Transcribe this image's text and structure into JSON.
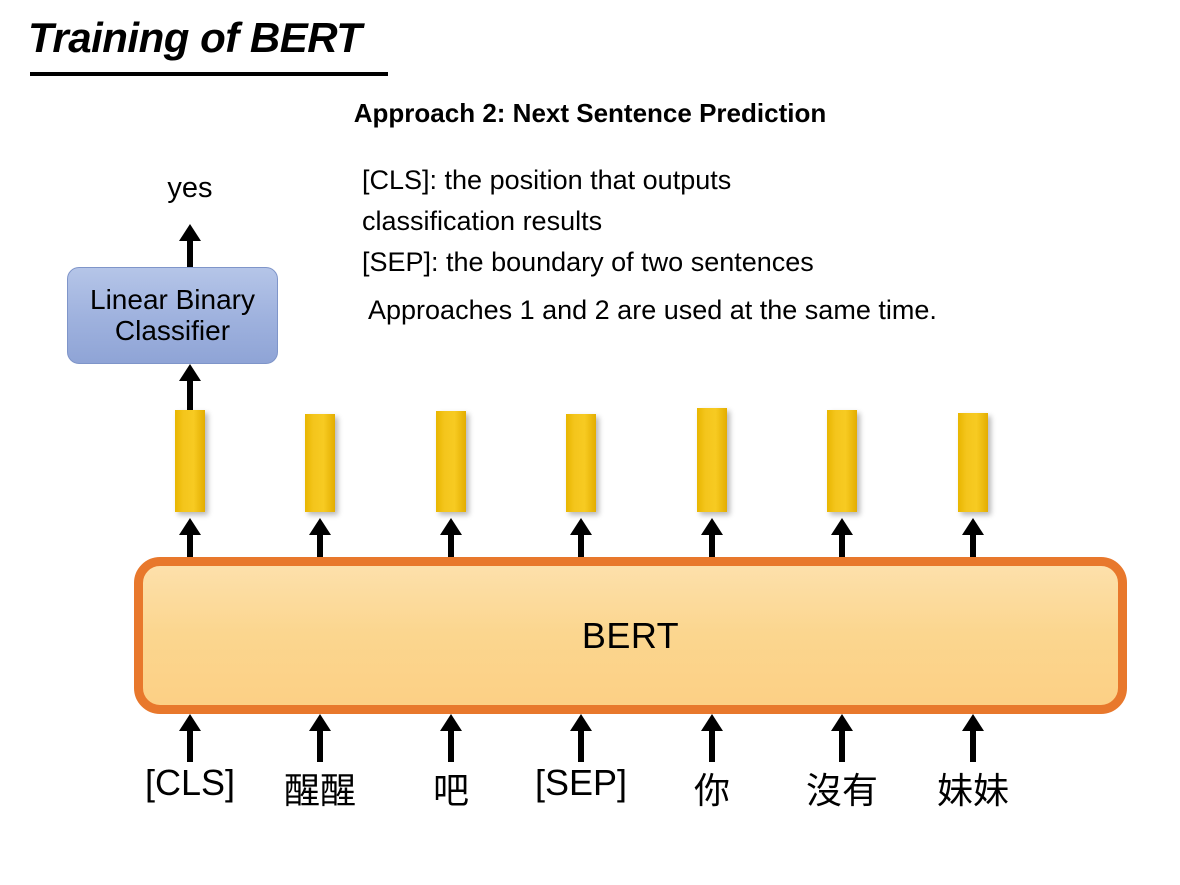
{
  "slide": {
    "title": "Training of BERT",
    "subtitle": "Approach 2: Next Sentence Prediction"
  },
  "notes": {
    "lines": [
      "[CLS]: the position that outputs",
      "classification results",
      "[SEP]: the boundary of two sentences"
    ],
    "footer": "Approaches 1 and 2 are used at the same time."
  },
  "diagram": {
    "output_label": "yes",
    "classifier": {
      "line1": "Linear Binary",
      "line2": "Classifier"
    },
    "encoder_label": "BERT",
    "tokens": [
      {
        "text": "[CLS]",
        "cjk": false
      },
      {
        "text": "醒醒",
        "cjk": true
      },
      {
        "text": "吧",
        "cjk": true
      },
      {
        "text": "[SEP]",
        "cjk": false
      },
      {
        "text": "你",
        "cjk": true
      },
      {
        "text": "沒有",
        "cjk": true
      },
      {
        "text": "妹妹",
        "cjk": true
      }
    ],
    "embedding_bars": 7,
    "colors": {
      "bar": "#f4c51c",
      "bert_fill": "#fbd68f",
      "bert_border": "#e8782c",
      "classifier_fill": "#9fb2de",
      "arrow": "#000000",
      "text": "#000000"
    }
  }
}
